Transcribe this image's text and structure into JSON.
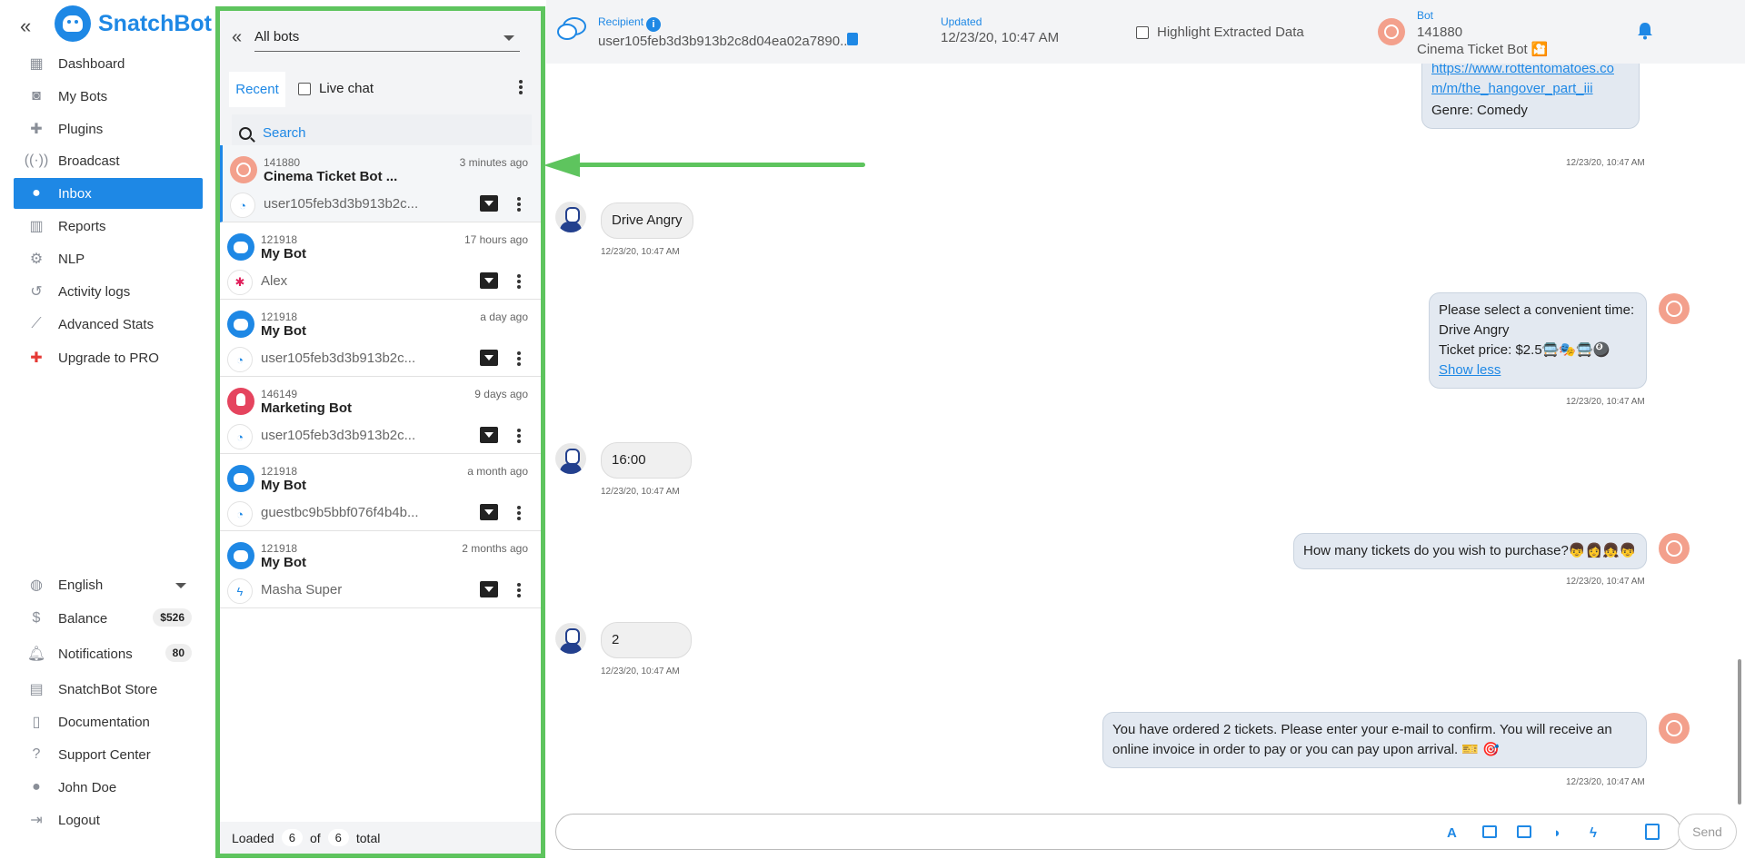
{
  "brand": {
    "name": "SnatchBot"
  },
  "nav": {
    "items": [
      {
        "label": "Dashboard",
        "icon": "dashboard-icon"
      },
      {
        "label": "My Bots",
        "icon": "robot-icon"
      },
      {
        "label": "Plugins",
        "icon": "puzzle-icon"
      },
      {
        "label": "Broadcast",
        "icon": "broadcast-icon"
      },
      {
        "label": "Inbox",
        "icon": "chat-bubbles-icon"
      },
      {
        "label": "Reports",
        "icon": "bar-chart-icon"
      },
      {
        "label": "NLP",
        "icon": "nlp-icon"
      },
      {
        "label": "Activity logs",
        "icon": "activity-icon"
      },
      {
        "label": "Advanced Stats",
        "icon": "line-chart-icon"
      },
      {
        "label": "Upgrade to PRO",
        "icon": "upgrade-icon"
      }
    ],
    "active_item": "Inbox",
    "bottom": {
      "language": "English",
      "balance_label": "Balance",
      "balance_value": "$526",
      "notifications_label": "Notifications",
      "notifications_count": "80",
      "store": "SnatchBot Store",
      "documentation": "Documentation",
      "support": "Support Center",
      "user": "John Doe",
      "logout": "Logout"
    }
  },
  "list": {
    "bot_filter": "All bots",
    "tab_recent": "Recent",
    "livechat_label": "Live chat",
    "search_placeholder": "Search",
    "conversations": [
      {
        "bot_id": "141880",
        "time": "3 minutes ago",
        "bot_name": "Cinema Ticket Bot ...",
        "user": "user105feb3d3b913b2c...",
        "channel": "webchat",
        "avatar": "film"
      },
      {
        "bot_id": "121918",
        "time": "17 hours ago",
        "bot_name": "My Bot",
        "user": "Alex",
        "channel": "slack",
        "avatar": "robot"
      },
      {
        "bot_id": "121918",
        "time": "a day ago",
        "bot_name": "My Bot",
        "user": "user105feb3d3b913b2c...",
        "channel": "webchat",
        "avatar": "robot"
      },
      {
        "bot_id": "146149",
        "time": "9 days ago",
        "bot_name": "Marketing Bot",
        "user": "user105feb3d3b913b2c...",
        "channel": "webchat",
        "avatar": "bulb"
      },
      {
        "bot_id": "121918",
        "time": "a month ago",
        "bot_name": "My Bot",
        "user": "guestbc9b5bbf076f4b4b...",
        "channel": "webchat",
        "avatar": "robot"
      },
      {
        "bot_id": "121918",
        "time": "2 months ago",
        "bot_name": "My Bot",
        "user": "Masha Super",
        "channel": "messenger",
        "avatar": "robot"
      }
    ],
    "footer": {
      "loaded_label": "Loaded",
      "loaded": "6",
      "of_label": "of",
      "total": "6",
      "total_label": "total"
    }
  },
  "chat_header": {
    "recipient_label": "Recipient",
    "recipient_id": "user105feb3d3b913b2c8d04ea02a7890...",
    "updated_label": "Updated",
    "updated_value": "12/23/20, 10:47 AM",
    "highlight_label": "Highlight Extracted Data",
    "bot_label": "Bot",
    "bot_id": "141880",
    "bot_name": "Cinema Ticket Bot 🎦"
  },
  "messages": {
    "m0_link_line1": "https://www.rottentomatoes.co",
    "m0_link_line2": "m/m/the_hangover_part_iii",
    "m0_genre": "Genre: Comedy",
    "m0_time": "12/23/20, 10:47 AM",
    "m1_text": "Drive Angry",
    "m1_time": "12/23/20, 10:47 AM",
    "m2_line1": "Please select a convenient time:",
    "m2_line2": "Drive Angry",
    "m2_line3": "Ticket price: $2.5🚍🎭🚍🎱",
    "m2_show_less": "Show less",
    "m2_time": "12/23/20, 10:47 AM",
    "m3_text": "16:00",
    "m3_time": "12/23/20, 10:47 AM",
    "m4_text": "How many tickets do you wish to purchase?👦👩👧👦",
    "m4_time": "12/23/20, 10:47 AM",
    "m5_text": "2",
    "m5_time": "12/23/20, 10:47 AM",
    "m6_line1": "You have ordered 2 tickets. Please enter your e-mail to confirm. You will receive an",
    "m6_line2": "online invoice in order to pay or you can pay upon arrival. 🎫 🎯",
    "m6_time": "12/23/20, 10:47 AM"
  },
  "composer": {
    "send_label": "Send"
  },
  "colors": {
    "accent": "#1e88e5",
    "highlight_frame": "#5ec45e",
    "bot_bubble": "#e3e9f1"
  }
}
